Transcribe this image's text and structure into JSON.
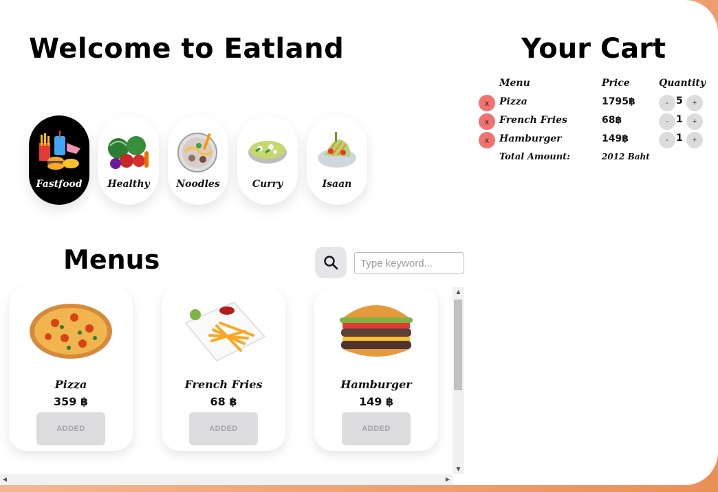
{
  "header": {
    "title": "Welcome to Eatland"
  },
  "categories": [
    {
      "label": "Fastfood",
      "icon": "fastfood-icon",
      "active": true
    },
    {
      "label": "Healthy",
      "icon": "vegetables-icon",
      "active": false
    },
    {
      "label": "Noodles",
      "icon": "noodle-bowl-icon",
      "active": false
    },
    {
      "label": "Curry",
      "icon": "curry-bowl-icon",
      "active": false
    },
    {
      "label": "Isaan",
      "icon": "papaya-salad-icon",
      "active": false
    }
  ],
  "menus": {
    "title": "Menus",
    "search_placeholder": "Type keyword...",
    "items": [
      {
        "name": "Pizza",
        "price": "359 ฿",
        "button": "ADDED",
        "icon": "pizza-icon"
      },
      {
        "name": "French Fries",
        "price": "68 ฿",
        "button": "ADDED",
        "icon": "french-fries-icon"
      },
      {
        "name": "Hamburger",
        "price": "149 ฿",
        "button": "ADDED",
        "icon": "hamburger-icon"
      }
    ]
  },
  "cart": {
    "title": "Your Cart",
    "headers": {
      "menu": "Menu",
      "price": "Price",
      "quantity": "Quantity"
    },
    "remove_label": "x",
    "minus_label": "-",
    "plus_label": "+",
    "rows": [
      {
        "name": "Pizza",
        "price": "1795฿",
        "qty": "5"
      },
      {
        "name": "French Fries",
        "price": "68฿",
        "qty": "1"
      },
      {
        "name": "Hamburger",
        "price": "149฿",
        "qty": "1"
      }
    ],
    "total_label": "Total Amount:",
    "total_value": "2012 Baht"
  },
  "colors": {
    "active_category_bg": "#000000",
    "remove_button": "#f27272",
    "added_button": "#dcdcde",
    "page_background_accent": "#f1a77a"
  }
}
